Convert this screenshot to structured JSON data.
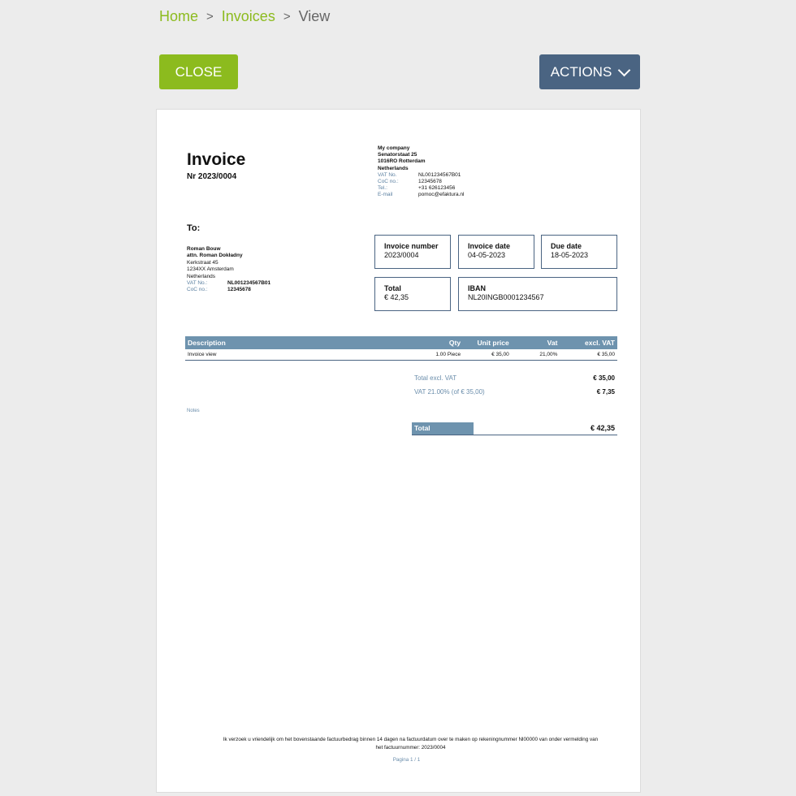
{
  "breadcrumb": {
    "home": "Home",
    "invoices": "Invoices",
    "current": "View",
    "separator": ">"
  },
  "buttons": {
    "close": "CLOSE",
    "actions": "ACTIONS"
  },
  "invoice": {
    "title": "Invoice",
    "number_line": "Nr 2023/0004",
    "company": {
      "name": "My company",
      "street": "Senatorstaat 25",
      "city": "1016RO Rotterdam",
      "country": "Netherlands",
      "vat_label": "VAT No.",
      "vat_value": "NL001234567B01",
      "coc_label": "CoC no.:",
      "coc_value": "12345678",
      "tel_label": "Tel.:",
      "tel_value": "+31 626123456",
      "email_label": "E-mail",
      "email_value": "pomoc@efaktura.nl"
    },
    "to_label": "To:",
    "client": {
      "name": "Roman Bouw",
      "attn": "attn. Roman Dokładny",
      "street": "Kerkstraat 45",
      "city": "1234XX Amsterdam",
      "country": "Netherlands",
      "vat_label": "VAT No.:",
      "vat_value": "NL001234567B01",
      "coc_label": "CoC no.:",
      "coc_value": "12345678"
    },
    "boxes": {
      "invoice_number_label": "Invoice number",
      "invoice_number": "2023/0004",
      "invoice_date_label": "Invoice date",
      "invoice_date": "04-05-2023",
      "due_date_label": "Due date",
      "due_date": "18-05-2023",
      "total_label": "Total",
      "total": "€ 42,35",
      "iban_label": "IBAN",
      "iban": "NL20INGB0001234567"
    },
    "table": {
      "headers": {
        "description": "Description",
        "qty": "Qty",
        "unit_price": "Unit price",
        "vat": "Vat",
        "excl_vat": "excl. VAT"
      },
      "rows": [
        {
          "description": "Invoice view",
          "qty": "1.00 Piece",
          "unit_price": "€ 35,00",
          "vat": "21,00%",
          "excl_vat": "€ 35,00"
        }
      ]
    },
    "summary": {
      "total_excl_label": "Total excl. VAT",
      "total_excl": "€ 35,00",
      "vat_label": "VAT 21.00% (of € 35,00)",
      "vat": "€ 7,35",
      "total_label": "Total",
      "total": "€ 42,35"
    },
    "notes_label": "Notes",
    "footer_line1": "Ik verzoek u vriendelijk om het bovenstaande factuurbedrag binnen 14 dagen na factuurdatum over te maken op rekeningnummer Nl00000 van  onder vermelding van",
    "footer_line2": "het factuurnummer: 2023/0004",
    "page_number": "Pagina 1 / 1"
  },
  "colors": {
    "green": "#8cbb1e",
    "navy": "#4a6482",
    "table_header": "#6e93ae",
    "label_blue": "#5a7fa0"
  }
}
